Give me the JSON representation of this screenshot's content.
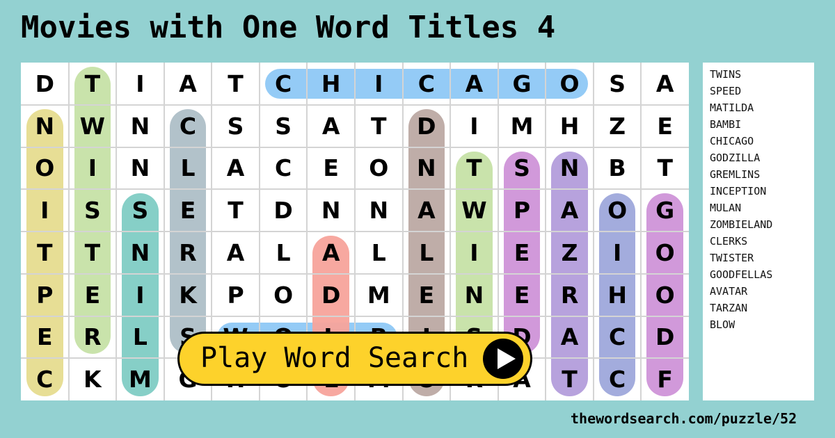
{
  "title": "Movies with One Word Titles 4",
  "grid": [
    [
      "D",
      "T",
      "I",
      "A",
      "T",
      "C",
      "H",
      "I",
      "C",
      "A",
      "G",
      "O",
      "S",
      "A"
    ],
    [
      "N",
      "W",
      "N",
      "C",
      "S",
      "S",
      "A",
      "T",
      "D",
      "I",
      "M",
      "H",
      "Z",
      "E"
    ],
    [
      "O",
      "I",
      "N",
      "L",
      "A",
      "C",
      "E",
      "O",
      "N",
      "T",
      "S",
      "N",
      "B",
      "T"
    ],
    [
      "I",
      "S",
      "S",
      "E",
      "T",
      "D",
      "N",
      "N",
      "A",
      "W",
      "P",
      "A",
      "O",
      "G"
    ],
    [
      "T",
      "T",
      "N",
      "R",
      "A",
      "L",
      "A",
      "L",
      "L",
      "I",
      "E",
      "Z",
      "I",
      "O"
    ],
    [
      "P",
      "E",
      "I",
      "K",
      "P",
      "O",
      "D",
      "M",
      "E",
      "N",
      "E",
      "R",
      "H",
      "O"
    ],
    [
      "E",
      "R",
      "L",
      "S",
      "W",
      "O",
      "L",
      "B",
      "I",
      "S",
      "D",
      "A",
      "C",
      "D"
    ],
    [
      "C",
      "K",
      "M",
      "G",
      "H",
      "O",
      "L",
      "M",
      "O",
      "R",
      "A",
      "T",
      "C",
      "F"
    ]
  ],
  "highlights": [
    {
      "word": "INCEPTION",
      "color": "#e6dc8f",
      "dir": "v",
      "index": 0,
      "from": 1,
      "to": 7
    },
    {
      "word": "TWISTER",
      "color": "#c6e2a6",
      "dir": "v",
      "index": 1,
      "from": 0,
      "to": 6
    },
    {
      "word": "GREMLINS",
      "color": "#80ccc4",
      "dir": "v",
      "index": 2,
      "from": 3,
      "to": 7
    },
    {
      "word": "CLERKS",
      "color": "#aebfc7",
      "dir": "v",
      "index": 3,
      "from": 1,
      "to": 6
    },
    {
      "word": "CHICAGO",
      "color": "#8ec8f5",
      "dir": "h",
      "index": 0,
      "from": 5,
      "to": 11
    },
    {
      "word": "BLOW",
      "color": "#8ec8f5",
      "dir": "h",
      "index": 6,
      "from": 4,
      "to": 7
    },
    {
      "word": "AVATAR",
      "color": "#f7a39b",
      "dir": "v",
      "index": 6,
      "from": 4,
      "to": 7
    },
    {
      "word": "ZOMBIELAND",
      "color": "#bca9a3",
      "dir": "v",
      "index": 8,
      "from": 1,
      "to": 7
    },
    {
      "word": "TWINS",
      "color": "#c6e2a6",
      "dir": "v",
      "index": 9,
      "from": 2,
      "to": 6
    },
    {
      "word": "SPEED",
      "color": "#cf93d8",
      "dir": "v",
      "index": 10,
      "from": 2,
      "to": 6
    },
    {
      "word": "TARZAN",
      "color": "#b39ddb",
      "dir": "v",
      "index": 11,
      "from": 2,
      "to": 7
    },
    {
      "word": "GODZILLA",
      "color": "#9ea8db",
      "dir": "v",
      "index": 12,
      "from": 3,
      "to": 7
    },
    {
      "word": "GOODFELLAS",
      "color": "#cf93d8",
      "dir": "v",
      "index": 13,
      "from": 3,
      "to": 7
    }
  ],
  "word_list": [
    "TWINS",
    "SPEED",
    "MATILDA",
    "BAMBI",
    "CHICAGO",
    "GODZILLA",
    "GREMLINS",
    "INCEPTION",
    "MULAN",
    "ZOMBIELAND",
    "CLERKS",
    "TWISTER",
    "GOODFELLAS",
    "AVATAR",
    "TARZAN",
    "BLOW"
  ],
  "play_button": {
    "label": "Play Word Search",
    "icon": "play-icon"
  },
  "footer": {
    "url": "thewordsearch.com/puzzle/52"
  },
  "colors": {
    "background": "#93d1d1",
    "button": "#fdd22b"
  }
}
